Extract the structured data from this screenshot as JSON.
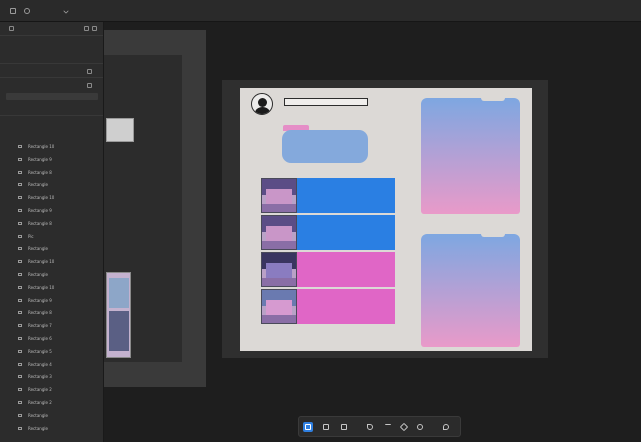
{
  "topbar": {
    "menu_icon": "grid-icon",
    "file_label": "",
    "page_label": "",
    "share_label": ""
  },
  "left_panel": {
    "tools_icon": "pen-icon",
    "file": {
      "label": "",
      "sublabel": ""
    },
    "page": {
      "label": "",
      "value": ""
    },
    "pages_section": {
      "label": "",
      "items": [
        "",
        ""
      ]
    },
    "layers_label": "",
    "frame_name": "",
    "layers": [
      "Rectangle 10",
      "Rectangle 9",
      "Rectangle 8",
      "Rectangle",
      "Rectangle 10",
      "Rectangle 9",
      "Rectangle 8",
      "Pic",
      "Rectangle",
      "Rectangle 10",
      "Rectangle",
      "Rectangle 10",
      "Rectangle 9",
      "Rectangle 8",
      "Rectangle 7",
      "Rectangle 6",
      "Rectangle 5",
      "Rectangle 4",
      "Rectangle 3",
      "Rectangle 2",
      "Rectangle 2",
      "Rectangle",
      "Rectangle"
    ]
  },
  "canvas": {
    "artboard_label": "",
    "profile": {
      "avatar_icon": "user-silhouette-icon",
      "name_text": ""
    }
  },
  "colors": {
    "accent": "#2f7fe0",
    "blue_bar": "#2a7fe3",
    "pink_bar": "#e066c6",
    "card_blue": "#84a9dc",
    "gradient_top": "#7ea7e1",
    "gradient_bottom": "#e99ac9"
  },
  "toolbar": {
    "tools": [
      "move-tool-icon",
      "frame-tool-icon",
      "shape-tool-icon",
      "pen-tool-icon",
      "text-tool-icon",
      "component-icon",
      "hand-tool-icon",
      "comment-icon"
    ]
  }
}
